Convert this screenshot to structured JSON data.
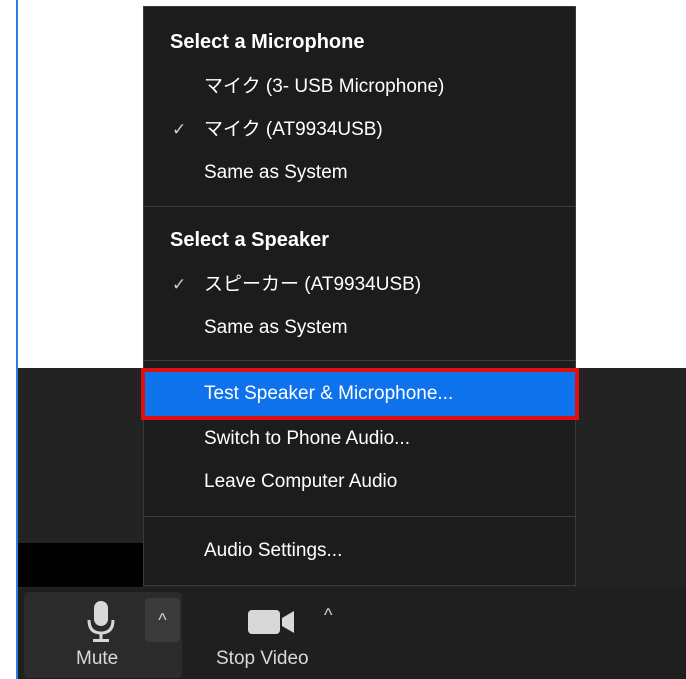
{
  "menu": {
    "microphone_header": "Select a Microphone",
    "microphones": [
      {
        "label": "マイク (3- USB Microphone)",
        "selected": false
      },
      {
        "label": "マイク (AT9934USB)",
        "selected": true
      },
      {
        "label": "Same as System",
        "selected": false
      }
    ],
    "speaker_header": "Select a Speaker",
    "speakers": [
      {
        "label": "スピーカー (AT9934USB)",
        "selected": true
      },
      {
        "label": "Same as System",
        "selected": false
      }
    ],
    "actions": {
      "test": "Test Speaker & Microphone...",
      "switch_phone": "Switch to Phone Audio...",
      "leave_audio": "Leave Computer Audio",
      "settings": "Audio Settings..."
    },
    "check_glyph": "✓"
  },
  "toolbar": {
    "mute_label": "Mute",
    "stop_video_label": "Stop Video",
    "caret_glyph": "^"
  },
  "colors": {
    "highlight_blue": "#0e72ed",
    "annotation_red": "#e01010"
  }
}
